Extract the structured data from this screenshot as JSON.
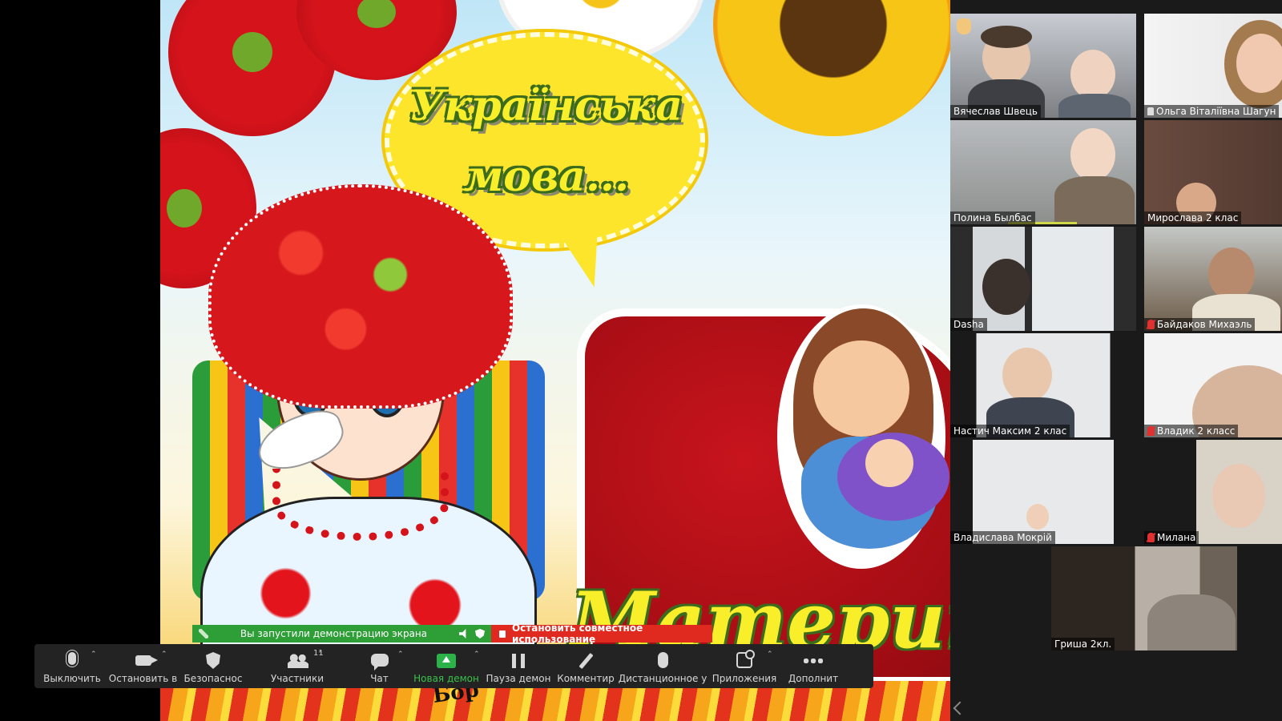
{
  "slide": {
    "title_line1": "Українська",
    "title_line2": "мова...",
    "bottom_title": "Материн",
    "signature": "Бор"
  },
  "gallery": {
    "tiles": [
      {
        "name": "Вячеслав Швець",
        "muted": false,
        "hand_raised": true,
        "active": false
      },
      {
        "name": "Ольга Віталіївна Шагун",
        "muted": false,
        "pinned": true,
        "active": true
      },
      {
        "name": "Полина Былбас",
        "muted": false,
        "speaking": true
      },
      {
        "name": "Мирослава 2 клас",
        "muted": false
      },
      {
        "name": "Dasha",
        "muted": false
      },
      {
        "name": "Байдаков Михаэль",
        "muted": true
      },
      {
        "name": "Настич Максим 2 клас",
        "muted": false
      },
      {
        "name": "Владик 2 класс",
        "muted": true
      },
      {
        "name": "Владислава Мокрій",
        "muted": false
      },
      {
        "name": "Милана",
        "muted": true
      },
      {
        "name": "Гриша 2кл.",
        "muted": false
      }
    ]
  },
  "share_banner": {
    "status_text": "Вы запустили демонстрацию экрана",
    "stop_label": "Остановить совместное использование"
  },
  "toolbar": {
    "mute_label": "Выключить",
    "video_label": "Остановить в",
    "security_label": "Безопаснос",
    "participants_label": "Участники",
    "participants_count": "11",
    "chat_label": "Чат",
    "new_share_label": "Новая демон",
    "pause_share_label": "Пауза демон",
    "annotate_label": "Комментир",
    "remote_control_label": "Дистанционное у",
    "apps_label": "Приложения",
    "more_label": "Дополнит"
  },
  "colors": {
    "share_green": "#2e9e37",
    "stop_red": "#e02a20",
    "toolbar_bg": "#232323",
    "active_speaker_outline": "#e4e36b",
    "new_share_green": "#39c24a"
  }
}
